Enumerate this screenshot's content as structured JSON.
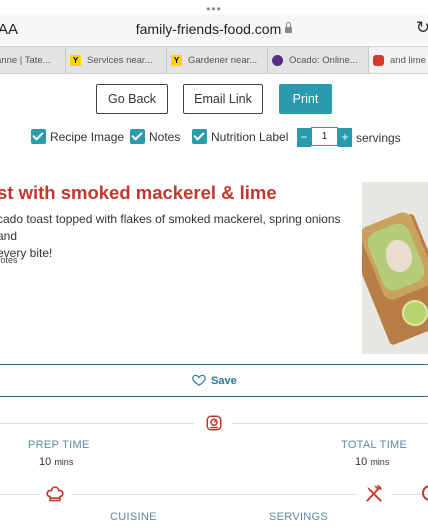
{
  "browser": {
    "dots": "•••",
    "text_size": "AA",
    "url": "family-friends-food.com",
    "reload": "↻",
    "tabs": [
      {
        "label": "anne | Tate...",
        "icon": "none"
      },
      {
        "label": "Services near...",
        "icon": "yellow-pages-icon"
      },
      {
        "label": "Gardener near...",
        "icon": "yellow-pages-icon"
      },
      {
        "label": "Ocado: Online...",
        "icon": "ocado-icon"
      },
      {
        "label": "and lime |",
        "icon": "site-favicon"
      }
    ]
  },
  "toolbar": {
    "go_back": "Go Back",
    "email_link": "Email Link",
    "print": "Print"
  },
  "options": {
    "recipe_image": "Recipe Image",
    "notes": "Notes",
    "nutrition_label": "Nutrition Label",
    "minus": "−",
    "plus": "+",
    "servings_value": "1",
    "servings_label": "servings"
  },
  "recipe": {
    "title": "st with smoked mackerel & lime",
    "description": "cado toast topped with flakes of smoked mackerel, spring onions and every bite!",
    "desc_line1": "cado toast topped with flakes of smoked mackerel, spring onions and",
    "desc_line2": " every bite!",
    "votes": "votes",
    "save": "Save"
  },
  "times": {
    "prep_label": "PREP TIME",
    "prep_value": "10",
    "prep_unit": "mins",
    "total_label": "TOTAL TIME",
    "total_value": "10",
    "total_unit": "mins"
  },
  "meta": {
    "cuisine_label": "CUISINE",
    "servings_label": "SERVINGS"
  },
  "colors": {
    "accent": "#2a9bac",
    "title": "#c0392b",
    "icon": "#c0392b"
  }
}
